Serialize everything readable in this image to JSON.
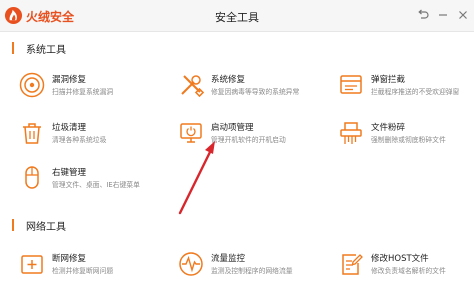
{
  "app": {
    "name": "火绒安全",
    "window_title": "安全工具"
  },
  "sections": [
    {
      "label": "系统工具",
      "tools": [
        {
          "title": "漏洞修复",
          "desc": "扫描并修复系统漏洞",
          "icon": "shield-repair-icon"
        },
        {
          "title": "系统修复",
          "desc": "修复因病毒等导致的系统异常",
          "icon": "wrench-screwdriver-icon"
        },
        {
          "title": "弹窗拦截",
          "desc": "拦截程序推送的不受欢迎弹窗",
          "icon": "popup-window-icon"
        },
        {
          "title": "垃圾清理",
          "desc": "清理各种系统垃圾",
          "icon": "trash-bin-icon"
        },
        {
          "title": "启动项管理",
          "desc": "管理开机软件的开机启动",
          "icon": "startup-monitor-icon"
        },
        {
          "title": "文件粉碎",
          "desc": "强制删除或彻底粉碎文件",
          "icon": "shredder-icon"
        },
        {
          "title": "右键管理",
          "desc": "管理文件、桌面、IE右键菜单",
          "icon": "mouse-icon"
        }
      ]
    },
    {
      "label": "网络工具",
      "tools": [
        {
          "title": "断网修复",
          "desc": "检测并修复断网问题",
          "icon": "network-repair-icon"
        },
        {
          "title": "流量监控",
          "desc": "监测及控制程序的网络流量",
          "icon": "traffic-monitor-icon"
        },
        {
          "title": "修改HOST文件",
          "desc": "修改负责域名解析的文件",
          "icon": "edit-file-icon"
        }
      ]
    }
  ],
  "colors": {
    "accent": "#f07a1e",
    "brand": "#e8511f",
    "annotation_arrow": "#d8262c"
  }
}
